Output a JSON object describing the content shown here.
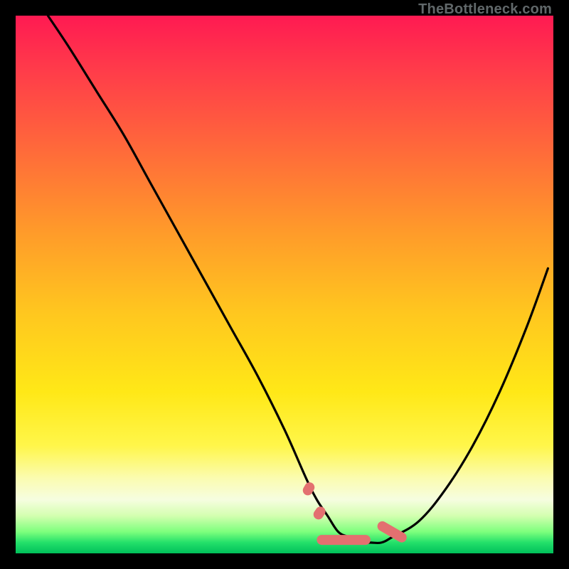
{
  "attribution": "TheBottleneck.com",
  "colors": {
    "background": "#000000",
    "gradient_top": "#ff1a52",
    "gradient_mid": "#ffe817",
    "gradient_bottom": "#00c05a",
    "curve": "#000000",
    "highlight": "#e37070"
  },
  "chart_data": {
    "type": "line",
    "title": "",
    "xlabel": "",
    "ylabel": "",
    "xlim": [
      0,
      100
    ],
    "ylim": [
      0,
      100
    ],
    "x": [
      6,
      10,
      15,
      20,
      25,
      30,
      35,
      40,
      45,
      50,
      54,
      56,
      58,
      60,
      62,
      64,
      66,
      68,
      70,
      75,
      80,
      85,
      90,
      95,
      99
    ],
    "values": [
      100,
      94,
      86,
      78,
      69,
      60,
      51,
      42,
      33,
      23,
      14,
      10,
      7,
      4,
      3,
      2,
      2,
      2,
      3,
      6,
      12,
      20,
      30,
      42,
      53
    ],
    "highlight_segments": [
      {
        "x": 54.5,
        "y": 12.0,
        "len": 2.5,
        "angle": -60
      },
      {
        "x": 56.5,
        "y": 7.5,
        "len": 2.5,
        "angle": -55
      },
      {
        "x": 61.0,
        "y": 2.5,
        "len": 10.0,
        "angle": 0
      },
      {
        "x": 70.0,
        "y": 4.0,
        "len": 6.0,
        "angle": 30
      }
    ]
  }
}
